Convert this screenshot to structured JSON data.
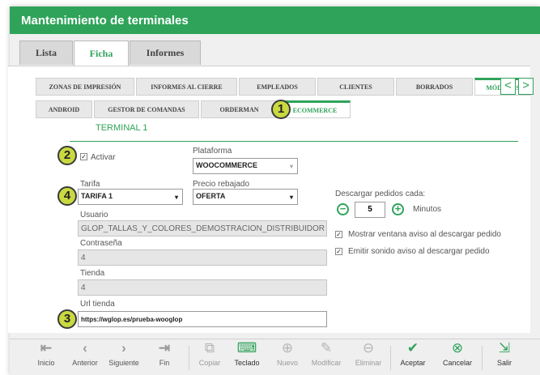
{
  "window": {
    "title": "Mantenimiento de terminales"
  },
  "top_tabs": [
    {
      "label": "Lista",
      "active": false
    },
    {
      "label": "Ficha",
      "active": true
    },
    {
      "label": "Informes",
      "active": false
    }
  ],
  "sub_tabs_row1": [
    {
      "label": "ZONAS DE IMPRESIÓN",
      "active": false
    },
    {
      "label": "INFORMES AL CIERRE",
      "active": false
    },
    {
      "label": "EMPLEADOS",
      "active": false
    },
    {
      "label": "CLIENTES",
      "active": false
    },
    {
      "label": "BORRADOS",
      "active": false
    },
    {
      "label": "MÓDULOS",
      "active": true
    }
  ],
  "sub_tabs_row2": [
    {
      "label": "ANDROID",
      "active": false
    },
    {
      "label": "GESTOR DE COMANDAS",
      "active": false
    },
    {
      "label": "ORDERMAN",
      "active": false
    },
    {
      "label": "ECOMMERCE",
      "active": true
    }
  ],
  "nav_arrows": {
    "prev": "<",
    "next": ">"
  },
  "section": {
    "title": "TERMINAL 1"
  },
  "badges": {
    "one": "1",
    "two": "2",
    "three": "3",
    "four": "4"
  },
  "form": {
    "activar_label": "Activar",
    "activar_checked": true,
    "plataforma_label": "Plataforma",
    "plataforma_value": "WOOCOMMERCE",
    "tarifa_label": "Tarifa",
    "tarifa_value": "TARIFA 1",
    "precio_label": "Precio rebajado",
    "precio_value": "OFERTA",
    "usuario_label": "Usuario",
    "usuario_value": "GLOP_TALLAS_Y_COLORES_DEMOSTRACION_DISTRIBUIDOR",
    "contrasena_label": "Contraseña",
    "contrasena_value": "4",
    "tienda_label": "Tienda",
    "tienda_value": "4",
    "url_label": "Url tienda",
    "url_value": "https://wglop.es/prueba-wooglop"
  },
  "descargar": {
    "label": "Descargar pedidos cada:",
    "value": "5",
    "unit": "Minutos",
    "minus": "−",
    "plus": "+"
  },
  "options": [
    {
      "label": "Mostrar ventana aviso al descargar pedido",
      "checked": true
    },
    {
      "label": "Emitir sonido aviso al descargar pedido",
      "checked": true
    }
  ],
  "toolbar": [
    {
      "label": "Inicio",
      "icon": "|<"
    },
    {
      "label": "Anterior",
      "icon": "<"
    },
    {
      "label": "Siguiente",
      "icon": ">"
    },
    {
      "label": "Fin",
      "icon": ">|"
    },
    {
      "label": "Copiar",
      "icon": "copy"
    },
    {
      "label": "Teclado",
      "icon": "keyboard"
    },
    {
      "label": "Nuevo",
      "icon": "plus-circle"
    },
    {
      "label": "Modificar",
      "icon": "pencil"
    },
    {
      "label": "Eliminar",
      "icon": "minus-circle"
    },
    {
      "label": "Aceptar",
      "icon": "check-circle"
    },
    {
      "label": "Cancelar",
      "icon": "x-circle"
    },
    {
      "label": "Salir",
      "icon": "exit"
    }
  ],
  "colors": {
    "accent": "#2fa35a",
    "badge": "#c9d940"
  }
}
